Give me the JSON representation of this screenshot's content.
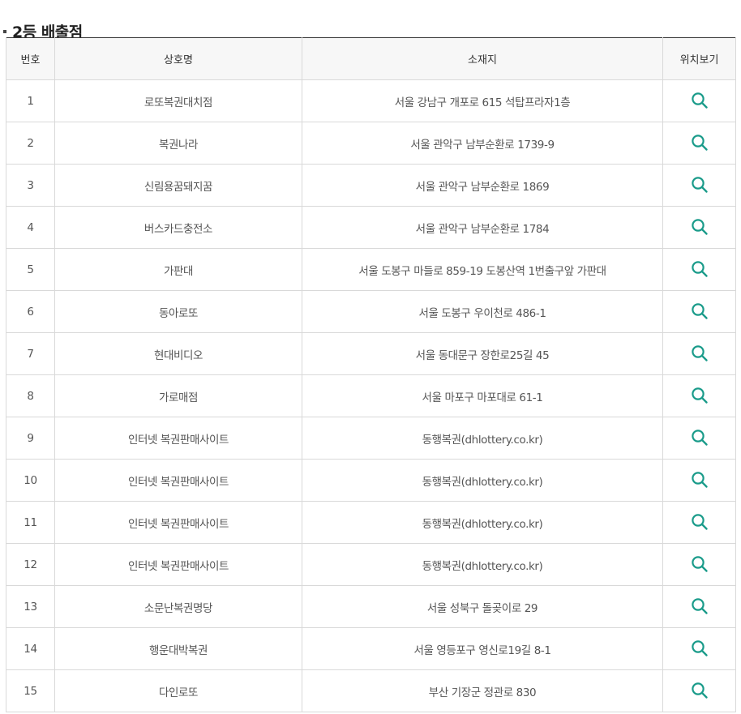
{
  "section": {
    "title": "2등 배출점"
  },
  "table": {
    "headers": {
      "no": "번호",
      "name": "상호명",
      "address": "소재지",
      "location": "위치보기"
    },
    "rows": [
      {
        "no": "1",
        "name": "로또복권대치점",
        "address": "서울 강남구 개포로 615 석탑프라자1층"
      },
      {
        "no": "2",
        "name": "복권나라",
        "address": "서울 관악구 남부순환로 1739-9"
      },
      {
        "no": "3",
        "name": "신림용꿈돼지꿈",
        "address": "서울 관악구 남부순환로 1869"
      },
      {
        "no": "4",
        "name": "버스카드충전소",
        "address": "서울 관악구 남부순환로 1784"
      },
      {
        "no": "5",
        "name": "가판대",
        "address": "서울 도봉구 마들로 859-19 도봉산역 1번출구앞 가판대"
      },
      {
        "no": "6",
        "name": "동아로또",
        "address": "서울 도봉구 우이천로 486-1"
      },
      {
        "no": "7",
        "name": "현대비디오",
        "address": "서울 동대문구 장한로25길 45"
      },
      {
        "no": "8",
        "name": "가로매점",
        "address": "서울 마포구 마포대로 61-1"
      },
      {
        "no": "9",
        "name": "인터넷 복권판매사이트",
        "address": "동행복권(dhlottery.co.kr)"
      },
      {
        "no": "10",
        "name": "인터넷 복권판매사이트",
        "address": "동행복권(dhlottery.co.kr)"
      },
      {
        "no": "11",
        "name": "인터넷 복권판매사이트",
        "address": "동행복권(dhlottery.co.kr)"
      },
      {
        "no": "12",
        "name": "인터넷 복권판매사이트",
        "address": "동행복권(dhlottery.co.kr)"
      },
      {
        "no": "13",
        "name": "소문난복권명당",
        "address": "서울 성북구 돌곶이로 29"
      },
      {
        "no": "14",
        "name": "행운대박복권",
        "address": "서울 영등포구 영신로19길 8-1"
      },
      {
        "no": "15",
        "name": "다인로또",
        "address": "부산 기장군 정관로 830"
      }
    ]
  },
  "icons": {
    "location": "search-icon"
  },
  "colors": {
    "accent": "#1a9b8a",
    "header_bg": "#f7f7f7",
    "border": "#d9d9d9",
    "top_rule": "#333333"
  }
}
